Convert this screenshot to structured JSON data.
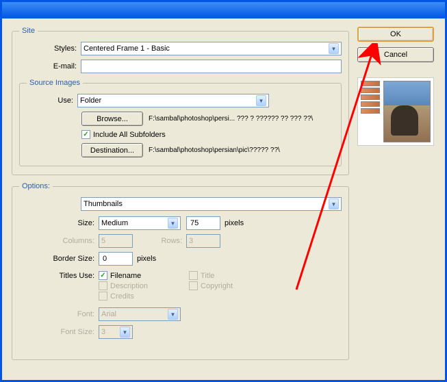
{
  "buttons": {
    "ok": "OK",
    "cancel": "Cancel",
    "browse": "Browse...",
    "destination": "Destination..."
  },
  "site": {
    "legend": "Site",
    "styles_label": "Styles:",
    "styles_value": "Centered Frame 1 - Basic",
    "email_label": "E-mail:",
    "email_value": ""
  },
  "source": {
    "legend": "Source Images",
    "use_label": "Use:",
    "use_value": "Folder",
    "browse_path": "F:\\sambal\\photoshop\\persi... ??? ? ?????? ?? ??? ??\\",
    "include_subfolders": "Include All Subfolders",
    "destination_path": "F:\\sambal\\photoshop\\persian\\pic\\????? ??\\"
  },
  "options": {
    "legend": "Options:",
    "dropdown_value": "Thumbnails",
    "size_label": "Size:",
    "size_value": "Medium",
    "size_px": "75",
    "pixels": "pixels",
    "columns_label": "Columns:",
    "columns_value": "5",
    "rows_label": "Rows:",
    "rows_value": "3",
    "border_label": "Border Size:",
    "border_value": "0",
    "titles_label": "Titles Use:",
    "cb_filename": "Filename",
    "cb_description": "Description",
    "cb_credits": "Credits",
    "cb_title": "Title",
    "cb_copyright": "Copyright",
    "font_label": "Font:",
    "font_value": "Arial",
    "fontsize_label": "Font Size:",
    "fontsize_value": "3"
  }
}
